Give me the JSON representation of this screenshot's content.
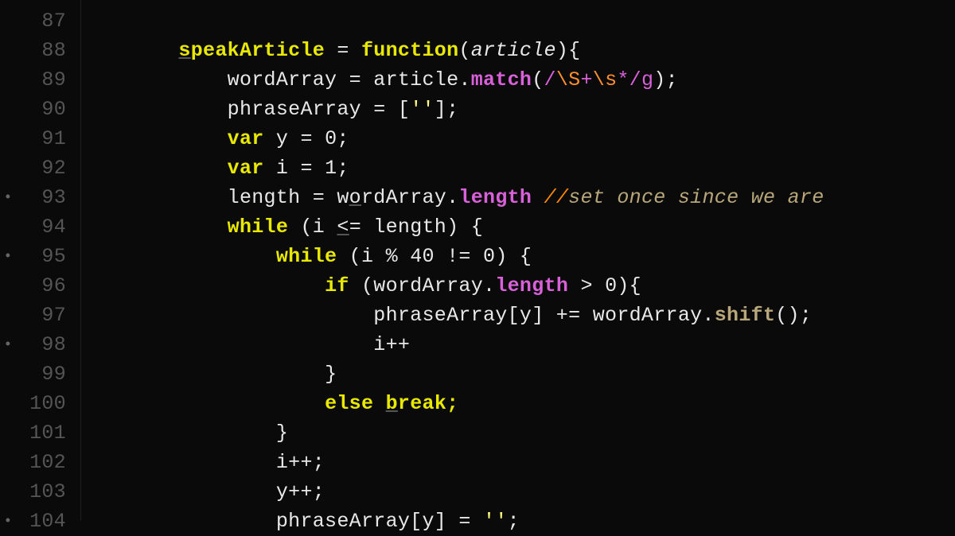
{
  "lines": {
    "87": {
      "num": "87",
      "mod": "",
      "indent": ""
    },
    "88": {
      "num": "88",
      "mod": "",
      "indent": "        ",
      "t1": "s",
      "t2": "peakArticle",
      "t3": " = ",
      "t4": "function",
      "t5": "(",
      "t6": "article",
      "t7": "){"
    },
    "89": {
      "num": "89",
      "mod": "",
      "indent": "            ",
      "t1": "wordArray = article.",
      "t2": "match",
      "t3": "(",
      "t4": "/",
      "t5": "\\S",
      "t6": "+",
      "t7": "\\s",
      "t8": "*/",
      "t9": "g",
      "t10": ");"
    },
    "90": {
      "num": "90",
      "mod": "",
      "indent": "            ",
      "t1": "phraseArray = [",
      "t2": "''",
      "t3": "];"
    },
    "91": {
      "num": "91",
      "mod": "",
      "indent": "            ",
      "t1": "var",
      "t2": " y = ",
      "t3": "0",
      "t4": ";"
    },
    "92": {
      "num": "92",
      "mod": "",
      "indent": "            ",
      "t1": "var",
      "t2": " i = ",
      "t3": "1",
      "t4": ";"
    },
    "93": {
      "num": "93",
      "mod": "•",
      "indent": "            ",
      "t1": "length = w",
      "t2": "o",
      "t3": "rdArray.",
      "t4": "length",
      "t5": " ",
      "t6": "//",
      "t7": "set once since we are "
    },
    "94": {
      "num": "94",
      "mod": "",
      "indent": "            ",
      "t1": "while",
      "t2": " (i ",
      "t3": "<",
      "t4": "= length) {"
    },
    "95": {
      "num": "95",
      "mod": "•",
      "indent": "                ",
      "t1": "while",
      "t2": " (i % ",
      "t3": "40",
      "t4": " != ",
      "t5": "0",
      "t6": ") {"
    },
    "96": {
      "num": "96",
      "mod": "",
      "indent": "                    ",
      "t1": "if",
      "t2": " (wordArray.",
      "t3": "length",
      "t4": " > ",
      "t5": "0",
      "t6": "){"
    },
    "97": {
      "num": "97",
      "mod": "",
      "indent": "                        ",
      "t1": "phraseArray[y] += wordArray.",
      "t2": "shift",
      "t3": "();"
    },
    "98": {
      "num": "98",
      "mod": "•",
      "indent": "                        ",
      "t1": "i++"
    },
    "99": {
      "num": "99",
      "mod": "",
      "indent": "                    ",
      "t1": "}"
    },
    "100": {
      "num": "100",
      "mod": "",
      "indent": "                    ",
      "t1": "else",
      "t2": " ",
      "t3": "b",
      "t4": "reak;"
    },
    "101": {
      "num": "101",
      "mod": "",
      "indent": "                ",
      "t1": "}"
    },
    "102": {
      "num": "102",
      "mod": "",
      "indent": "                ",
      "t1": "i++;"
    },
    "103": {
      "num": "103",
      "mod": "",
      "indent": "                ",
      "t1": "y++;"
    },
    "104": {
      "num": "104",
      "mod": "•",
      "indent": "                ",
      "t1": "phraseArray[y] = ",
      "t2": "''",
      "t3": ";"
    }
  }
}
